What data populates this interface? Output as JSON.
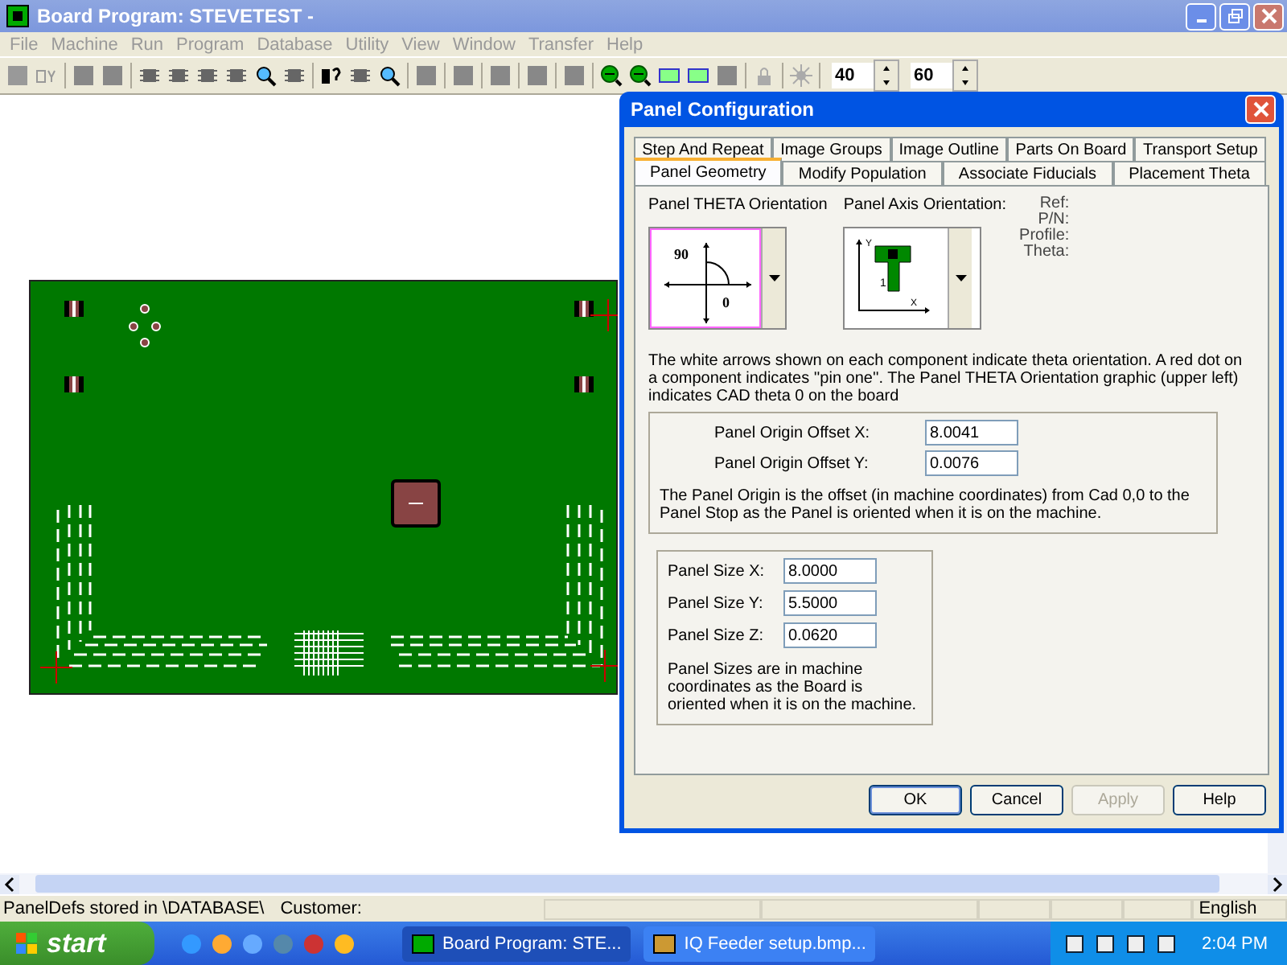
{
  "window": {
    "title": "Board Program:  STEVETEST -"
  },
  "menu": [
    "File",
    "Machine",
    "Run",
    "Program",
    "Database",
    "Utility",
    "View",
    "Window",
    "Transfer",
    "Help"
  ],
  "toolbar": {
    "spinners": [
      {
        "value": "40"
      },
      {
        "value": "60"
      }
    ]
  },
  "dialog": {
    "title": "Panel Configuration",
    "tab_rows": [
      [
        {
          "label": "Step And Repeat",
          "selected": false
        },
        {
          "label": "Image Groups",
          "selected": false
        },
        {
          "label": "Image Outline",
          "selected": false
        },
        {
          "label": "Parts On Board",
          "selected": false
        },
        {
          "label": "Transport Setup",
          "selected": false
        }
      ],
      [
        {
          "label": "Panel Geometry",
          "selected": true
        },
        {
          "label": "Modify Population",
          "selected": false
        },
        {
          "label": "Associate Fiducials",
          "selected": false
        },
        {
          "label": "Placement Theta",
          "selected": false
        }
      ]
    ],
    "theta": {
      "label": "Panel THETA Orientation",
      "label_90": "90",
      "label_0": "0"
    },
    "axis": {
      "label": "Panel Axis Orientation:",
      "y": "Y",
      "x": "X",
      "pin": "1"
    },
    "info_labels": [
      "Ref:",
      "P/N:",
      "Profile:",
      "Theta:"
    ],
    "note": "The white arrows shown on each component indicate theta orientation.  A red dot on a component indicates ''pin one''.  The Panel THETA Orientation graphic (upper left) indicates CAD theta 0 on the board",
    "origin": {
      "fields": [
        {
          "label": "Panel Origin Offset X:",
          "value": "8.0041"
        },
        {
          "label": "Panel Origin Offset Y:",
          "value": "0.0076"
        }
      ],
      "note": "The Panel Origin is the offset (in machine coordinates) from Cad 0,0 to the Panel Stop as the Panel is oriented when it is on the machine."
    },
    "size": {
      "fields": [
        {
          "label": "Panel Size X:",
          "value": "8.0000"
        },
        {
          "label": "Panel Size Y:",
          "value": "5.5000"
        },
        {
          "label": "Panel Size Z:",
          "value": "0.0620"
        }
      ],
      "note": "Panel Sizes are in machine coordinates as the Board is oriented when it is on the machine."
    },
    "buttons": [
      {
        "label": "OK",
        "disabled": false
      },
      {
        "label": "Cancel",
        "disabled": false
      },
      {
        "label": "Apply",
        "disabled": true
      },
      {
        "label": "Help",
        "disabled": false
      }
    ]
  },
  "status_bar": {
    "location": "PanelDefs stored in \\DATABASE\\",
    "customer": "Customer:",
    "language": "English"
  },
  "taskbar": {
    "start": "start",
    "tasks": [
      {
        "label": "Board Program:  STE...",
        "selected": true
      },
      {
        "label": "IQ Feeder setup.bmp...",
        "selected": false
      }
    ],
    "clock": "2:04 PM"
  }
}
